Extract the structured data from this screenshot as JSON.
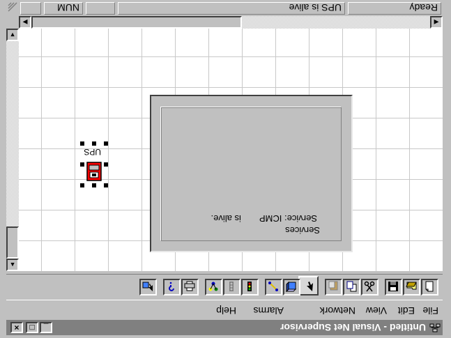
{
  "window": {
    "title": "Untitled - Visual Net Supervisor",
    "minimize_glyph": "_",
    "maximize_glyph": "□",
    "close_glyph": "×"
  },
  "menu": [
    "File",
    "Edit",
    "View",
    "Network",
    "Alarms",
    "Help"
  ],
  "toolbar": {
    "buttons": [
      {
        "name": "new-icon"
      },
      {
        "name": "open-icon"
      },
      {
        "name": "save-icon"
      },
      {
        "name": "cut-icon"
      },
      {
        "name": "copy-icon"
      },
      {
        "name": "paste-icon"
      },
      {
        "name": "select-arrow-icon",
        "pressed": true
      },
      {
        "name": "device-icon"
      },
      {
        "name": "link-tool-icon"
      },
      {
        "name": "traffic-light-icon"
      },
      {
        "name": "grey-light-icon"
      },
      {
        "name": "network-map-icon"
      },
      {
        "name": "printer-icon"
      },
      {
        "name": "help-icon"
      },
      {
        "name": "context-help-icon"
      }
    ]
  },
  "canvas": {
    "services_panel": {
      "group_label": "Services",
      "service_label": "Service: ICMP",
      "service_status": "is alive."
    },
    "device": {
      "label": "UPS",
      "status_color": "#ff0000"
    }
  },
  "scrollbars": {
    "up_arrow": "▲",
    "down_arrow": "▼",
    "left_arrow": "◀",
    "right_arrow": "▶"
  },
  "statusbar": {
    "ready": "Ready",
    "message": "UPS is alive",
    "num": "NUM"
  },
  "colors": {
    "face": "#c0c0c0",
    "title_bar": "#808080",
    "device_red": "#ff0000"
  }
}
